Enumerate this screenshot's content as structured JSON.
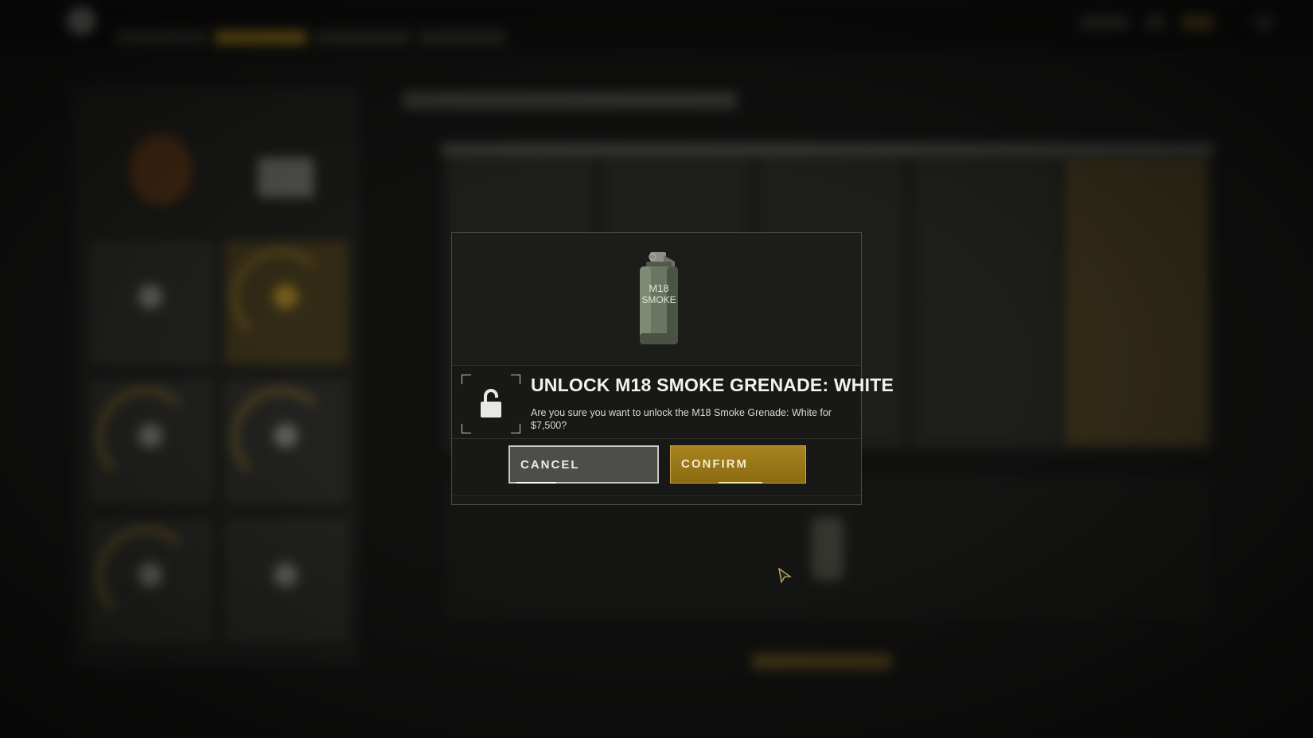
{
  "dialog": {
    "title": "UNLOCK M18 SMOKE GRENADE: WHITE",
    "message": "Are you sure you want to unlock the M18 Smoke Grenade: White for $7,500?",
    "item_label_line1": "M18",
    "item_label_line2": "SMOKE",
    "cancel_label": "CANCEL",
    "confirm_label": "CONFIRM",
    "lock_icon": "unlocked-padlock-icon",
    "accent_color": "#a8841f"
  }
}
